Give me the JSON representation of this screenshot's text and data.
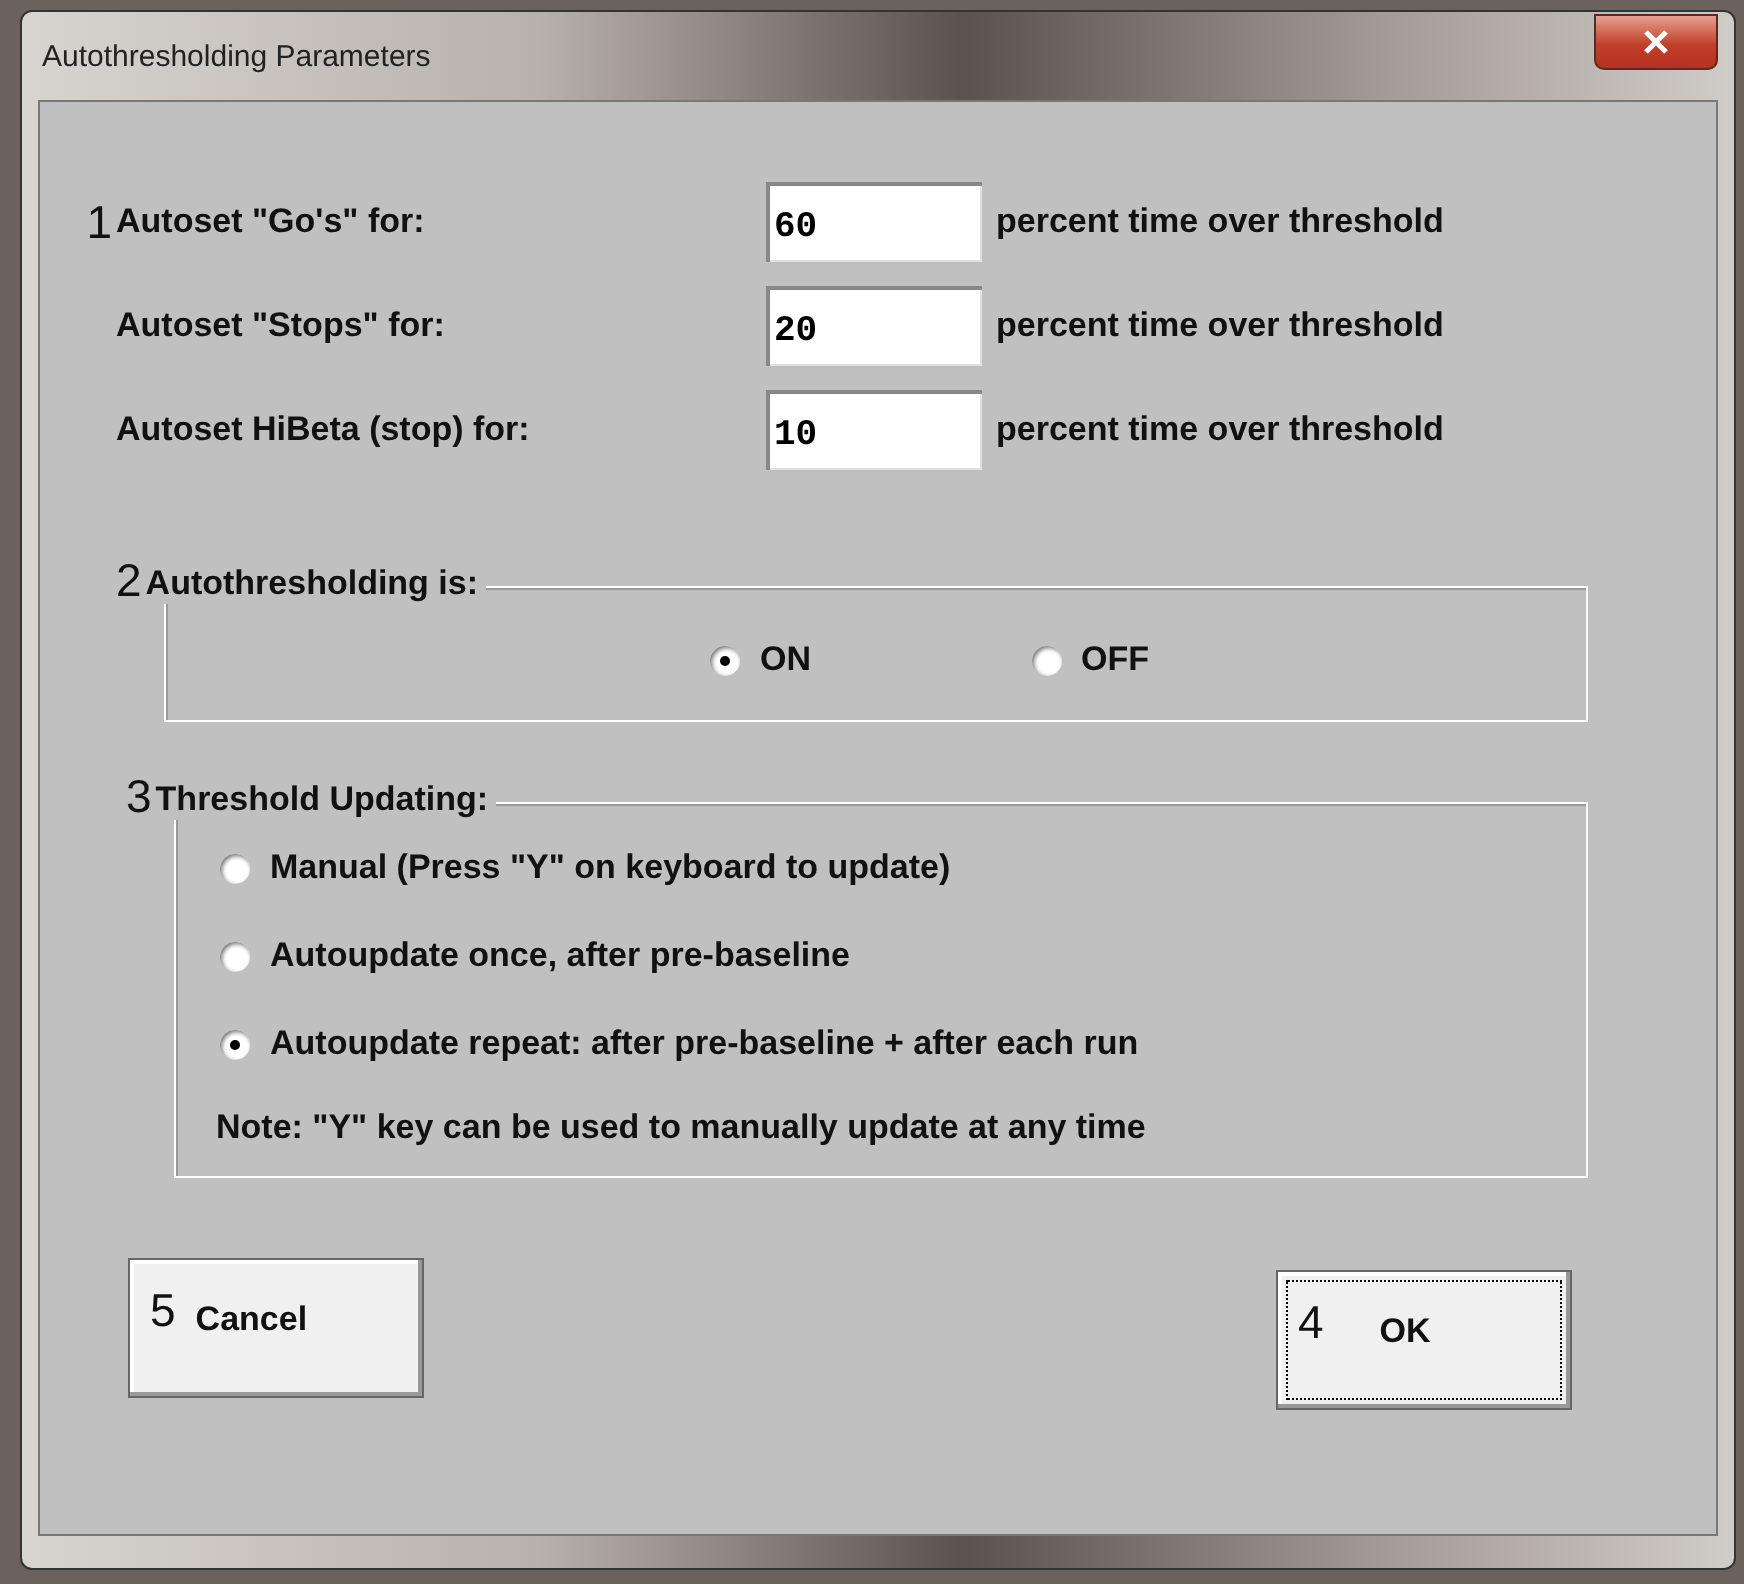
{
  "window": {
    "title": "Autothresholding Parameters"
  },
  "fields": [
    {
      "marker": "1",
      "label": "Autoset \"Go's\" for:",
      "value": "60",
      "unit": "percent time over threshold"
    },
    {
      "label": "Autoset \"Stops\" for:",
      "value": "20",
      "unit": "percent time over threshold"
    },
    {
      "label": "Autoset HiBeta (stop) for:",
      "value": "10",
      "unit": "percent time over threshold"
    }
  ],
  "autothresholding": {
    "marker": "2",
    "legend": "Autothresholding is:",
    "options": [
      {
        "label": "ON",
        "selected": true
      },
      {
        "label": "OFF",
        "selected": false
      }
    ]
  },
  "threshold_updating": {
    "marker": "3",
    "legend": "Threshold Updating:",
    "options": [
      {
        "label": "Manual (Press \"Y\" on keyboard to update)",
        "selected": false
      },
      {
        "label": "Autoupdate once, after pre-baseline",
        "selected": false
      },
      {
        "label": "Autoupdate repeat: after pre-baseline + after each run",
        "selected": true
      }
    ],
    "note": "Note: \"Y\" key can be used to manually update at any time"
  },
  "buttons": [
    {
      "marker": "5",
      "label": "Cancel",
      "focused": false
    },
    {
      "marker": "4",
      "label": "OK",
      "focused": true
    }
  ]
}
